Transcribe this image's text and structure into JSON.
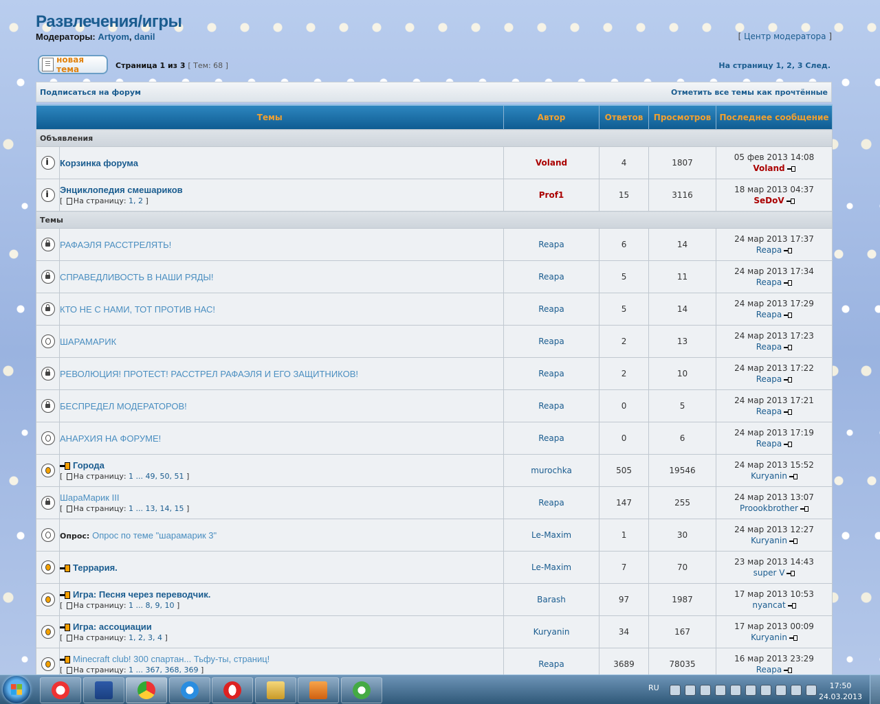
{
  "forum": {
    "title": "Развлечения/игры",
    "moderators_label": "Модераторы:",
    "moderators": [
      "Artyom",
      "danil"
    ],
    "moderator_center": "Центр модератора"
  },
  "actions": {
    "new_topic": "новая тема",
    "page_info": "Страница 1 из 3",
    "topics_count": "[ Тем: 68 ]",
    "pagenav_label": "На страницу",
    "pagenav_pages": [
      "1",
      "2",
      "3"
    ],
    "pagenav_next": "След.",
    "subscribe": "Подписаться на форум",
    "mark_read": "Отметить все темы как прочтённые"
  },
  "table": {
    "headers": [
      "Темы",
      "Автор",
      "Ответов",
      "Просмотров",
      "Последнее сообщение"
    ],
    "sections": [
      {
        "name": "Объявления",
        "rows": [
          {
            "icon": "announcement-icon",
            "prefix": "",
            "new": false,
            "title": "Корзинка форума",
            "style": "bold",
            "pages": "",
            "author": "Voland",
            "author_style": "red",
            "replies": "4",
            "views": "1807",
            "last_date": "05 фев 2013 14:08",
            "last_author": "Voland",
            "last_style": "red"
          },
          {
            "icon": "announcement-icon",
            "prefix": "",
            "new": false,
            "title": "Энциклопедия смешариков",
            "style": "bold",
            "pages": "1, 2",
            "author": "Prof1",
            "author_style": "red",
            "replies": "15",
            "views": "3116",
            "last_date": "18 мар 2013 04:37",
            "last_author": "SeDoV",
            "last_style": "red"
          }
        ]
      },
      {
        "name": "Темы",
        "rows": [
          {
            "icon": "locked-topic-icon",
            "prefix": "",
            "new": false,
            "title": "РАФАЭЛЯ РАССТРЕЛЯТЬ!",
            "style": "locked",
            "pages": "",
            "author": "Reapa",
            "author_style": "blue",
            "replies": "6",
            "views": "14",
            "last_date": "24 мар 2013 17:37",
            "last_author": "Reapa",
            "last_style": "blue"
          },
          {
            "icon": "locked-topic-icon",
            "prefix": "",
            "new": false,
            "title": "СПРАВЕДЛИВОСТЬ В НАШИ РЯДЫ!",
            "style": "locked",
            "pages": "",
            "author": "Reapa",
            "author_style": "blue",
            "replies": "5",
            "views": "11",
            "last_date": "24 мар 2013 17:34",
            "last_author": "Reapa",
            "last_style": "blue"
          },
          {
            "icon": "locked-topic-icon",
            "prefix": "",
            "new": false,
            "title": "КТО НЕ С НАМИ, ТОТ ПРОТИВ НАС!",
            "style": "locked",
            "pages": "",
            "author": "Reapa",
            "author_style": "blue",
            "replies": "5",
            "views": "14",
            "last_date": "24 мар 2013 17:29",
            "last_author": "Reapa",
            "last_style": "blue"
          },
          {
            "icon": "topic-icon",
            "prefix": "",
            "new": false,
            "title": "ШАРАМАРИК",
            "style": "locked",
            "pages": "",
            "author": "Reapa",
            "author_style": "blue",
            "replies": "2",
            "views": "13",
            "last_date": "24 мар 2013 17:23",
            "last_author": "Reapa",
            "last_style": "blue"
          },
          {
            "icon": "locked-topic-icon",
            "prefix": "",
            "new": false,
            "title": "РЕВОЛЮЦИЯ! ПРОТЕСТ! РАССТРЕЛ РАФАЭЛЯ И ЕГО ЗАЩИТНИКОВ!",
            "style": "locked",
            "pages": "",
            "author": "Reapa",
            "author_style": "blue",
            "replies": "2",
            "views": "10",
            "last_date": "24 мар 2013 17:22",
            "last_author": "Reapa",
            "last_style": "blue"
          },
          {
            "icon": "locked-topic-icon",
            "prefix": "",
            "new": false,
            "title": "БЕСПРЕДЕЛ МОДЕРАТОРОВ!",
            "style": "locked",
            "pages": "",
            "author": "Reapa",
            "author_style": "blue",
            "replies": "0",
            "views": "5",
            "last_date": "24 мар 2013 17:21",
            "last_author": "Reapa",
            "last_style": "blue"
          },
          {
            "icon": "topic-icon",
            "prefix": "",
            "new": false,
            "title": "АНАРХИЯ НА ФОРУМЕ!",
            "style": "locked",
            "pages": "",
            "author": "Reapa",
            "author_style": "blue",
            "replies": "0",
            "views": "6",
            "last_date": "24 мар 2013 17:19",
            "last_author": "Reapa",
            "last_style": "blue"
          },
          {
            "icon": "hot-topic-icon",
            "prefix": "",
            "new": true,
            "title": "Города",
            "style": "bold",
            "pages": "1 ... 49, 50, 51",
            "author": "murochka",
            "author_style": "blue",
            "replies": "505",
            "views": "19546",
            "last_date": "24 мар 2013 15:52",
            "last_author": "Kuryanin",
            "last_style": "blue"
          },
          {
            "icon": "locked-topic-icon",
            "prefix": "",
            "new": false,
            "title": "ШараМарик III",
            "style": "locked",
            "pages": "1 ... 13, 14, 15",
            "author": "Reapa",
            "author_style": "blue",
            "replies": "147",
            "views": "255",
            "last_date": "24 мар 2013 13:07",
            "last_author": "Proookbrother",
            "last_style": "blue"
          },
          {
            "icon": "topic-icon",
            "prefix": "Опрос:",
            "new": false,
            "title": "Опрос по теме \"шарамарик 3\"",
            "style": "locked",
            "pages": "",
            "author": "Le-Maxim",
            "author_style": "blue",
            "replies": "1",
            "views": "30",
            "last_date": "24 мар 2013 12:27",
            "last_author": "Kuryanin",
            "last_style": "blue"
          },
          {
            "icon": "hot-topic-icon",
            "prefix": "",
            "new": true,
            "title": "Террария.",
            "style": "bold",
            "pages": "",
            "author": "Le-Maxim",
            "author_style": "blue",
            "replies": "7",
            "views": "70",
            "last_date": "23 мар 2013 14:43",
            "last_author": "super V",
            "last_style": "blue"
          },
          {
            "icon": "hot-topic-icon",
            "prefix": "",
            "new": true,
            "title": "Игра: Песня через переводчик.",
            "style": "bold",
            "pages": "1 ... 8, 9, 10",
            "author": "Barash",
            "author_style": "blue",
            "replies": "97",
            "views": "1987",
            "last_date": "17 мар 2013 10:53",
            "last_author": "nyancat",
            "last_style": "blue"
          },
          {
            "icon": "hot-topic-icon",
            "prefix": "",
            "new": true,
            "title": "Игра: ассоциации",
            "style": "bold",
            "pages": "1, 2, 3, 4",
            "author": "Kuryanin",
            "author_style": "blue",
            "replies": "34",
            "views": "167",
            "last_date": "17 мар 2013 00:09",
            "last_author": "Kuryanin",
            "last_style": "blue"
          },
          {
            "icon": "hot-topic-icon",
            "prefix": "",
            "new": true,
            "title": "Minecraft club! 300 спартан... Тьфу-ты, страниц!",
            "style": "locked",
            "pages": "1 ... 367, 368, 369",
            "author": "Reapa",
            "author_style": "blue",
            "replies": "3689",
            "views": "78035",
            "last_date": "16 мар 2013 23:29",
            "last_author": "Reapa",
            "last_style": "blue"
          }
        ]
      }
    ],
    "pages_label": "На страницу:"
  },
  "taskbar": {
    "apps": [
      "yandex-icon",
      "word-icon",
      "chrome-icon",
      "ie-icon",
      "opera-icon",
      "explorer-icon",
      "media-player-icon",
      "utorrent-icon"
    ],
    "lang": "RU",
    "time": "17:50",
    "date": "24.03.2013"
  }
}
